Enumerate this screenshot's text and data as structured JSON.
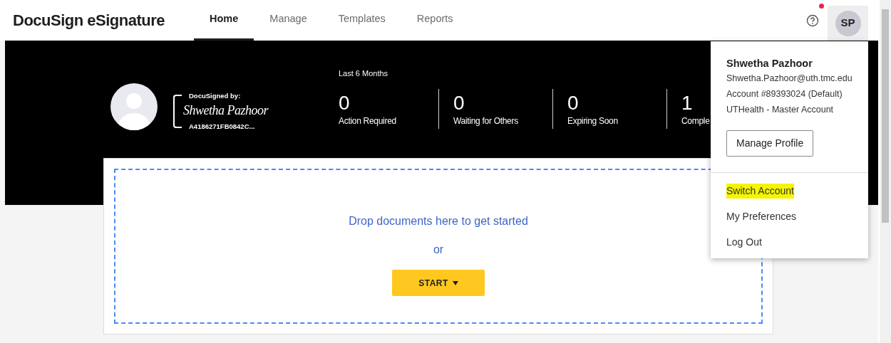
{
  "header": {
    "logo": "DocuSign eSignature",
    "tabs": [
      {
        "label": "Home",
        "selected": true
      },
      {
        "label": "Manage",
        "selected": false
      },
      {
        "label": "Templates",
        "selected": false
      },
      {
        "label": "Reports",
        "selected": false
      }
    ],
    "avatar_initials": "SP",
    "notification": true,
    "menu_open": true
  },
  "banner": {
    "signature": {
      "caption": "DocuSigned by:",
      "handwriting": "Shwetha Pazhoor",
      "id": "A4186271FB0842C..."
    },
    "period": "Last 6 Months",
    "stats": [
      {
        "value": "0",
        "label": "Action Required"
      },
      {
        "value": "0",
        "label": "Waiting for Others"
      },
      {
        "value": "0",
        "label": "Expiring Soon"
      },
      {
        "value": "1",
        "label": "Comple"
      }
    ]
  },
  "dropzone": {
    "prompt": "Drop documents here to get started",
    "or": "or",
    "button": "START"
  },
  "account_menu": {
    "name": "Shwetha Pazhoor",
    "email": "Shwetha.Pazhoor@uth.tmc.edu",
    "account": "Account #89393024 (Default)",
    "organization": "UTHealth - Master Account",
    "manage_button": "Manage Profile",
    "items": [
      {
        "label": "Switch Account",
        "highlighted": true
      },
      {
        "label": "My Preferences",
        "highlighted": false
      },
      {
        "label": "Log Out",
        "highlighted": false
      }
    ]
  }
}
